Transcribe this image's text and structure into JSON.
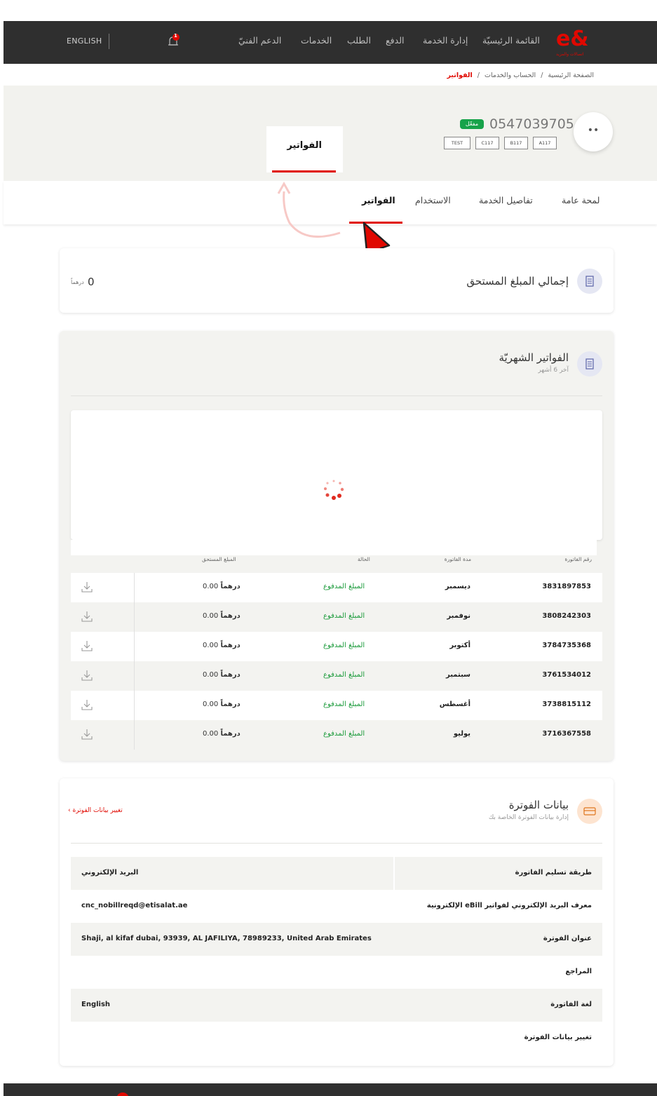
{
  "colors": {
    "brand_red": "#e00800",
    "header_bg": "#2f2f2f",
    "paid_green": "#1a9a3a",
    "active_green": "#17a34a"
  },
  "header": {
    "language_toggle": "ENGLISH",
    "notification_count": "1",
    "nav": [
      "القائمة الرئيسيّة",
      "إدارة الخدمة",
      "الدفع",
      "الطلب",
      "الخدمات",
      "الدعم الفنيّ"
    ],
    "logo_text": "e&",
    "logo_tagline": "اتصالات والمزيد"
  },
  "breadcrumb": {
    "home": "الصفحة الرئيسية",
    "sep": "/",
    "section": "الحساب والخدمات",
    "current": "الفواتير"
  },
  "profile": {
    "avatar": "••",
    "phone": "0547039705",
    "status": "مفعّل",
    "tags": [
      "A117",
      "B117",
      "C117",
      "TEST"
    ]
  },
  "zoom_card": {
    "label": "الفواتير"
  },
  "tabs": [
    "لمحة عامة",
    "تفاصيل الخدمة",
    "الاستخدام",
    "الفواتير"
  ],
  "total_due": {
    "title": "إجمالي المبلغ المستحق",
    "amount": "0",
    "currency": "درهماً"
  },
  "monthly_bills": {
    "title": "الفواتير الشهريّة",
    "subtitle": "آخر 6 أشهر",
    "columns": {
      "number": "رقم الفاتورة",
      "period": "مدة الفاتورة",
      "status": "الحالة",
      "amount": "المبلغ المستحق"
    },
    "rows": [
      {
        "number": "3831897853",
        "period": "ديسمبر",
        "status": "المبلغ المدفوع",
        "amount": "0.00",
        "currency": "درهماً"
      },
      {
        "number": "3808242303",
        "period": "نوفمبر",
        "status": "المبلغ المدفوع",
        "amount": "0.00",
        "currency": "درهماً"
      },
      {
        "number": "3784735368",
        "period": "أكتوبر",
        "status": "المبلغ المدفوع",
        "amount": "0.00",
        "currency": "درهماً"
      },
      {
        "number": "3761534012",
        "period": "سبتمبر",
        "status": "المبلغ المدفوع",
        "amount": "0.00",
        "currency": "درهماً"
      },
      {
        "number": "3738815112",
        "period": "أغسطس",
        "status": "المبلغ المدفوع",
        "amount": "0.00",
        "currency": "درهماً"
      },
      {
        "number": "3716367558",
        "period": "يوليو",
        "status": "المبلغ المدفوع",
        "amount": "0.00",
        "currency": "درهماً"
      }
    ]
  },
  "billing_info": {
    "title": "بيانات الفوترة",
    "subtitle": "إدارة بيانات الفوترة الخاصة بك",
    "change_link": "تغيير بيانات الفوترة",
    "rows": [
      {
        "label": "طريقة تسليم الفاتورة",
        "value": "البريد الإلكتروني"
      },
      {
        "label": "معرف البريد الإلكتروني لفواتير eBill الإلكترونية",
        "value": "cnc_nobillreqd@etisalat.ae"
      },
      {
        "label": "عنوان الفوترة",
        "value": "Shaji, al kifaf dubai, 93939, AL JAFILIYA, 78989233, United Arab Emirates"
      },
      {
        "label": "المراجع",
        "value": ""
      },
      {
        "label": "لغة الفاتورة",
        "value": "English"
      },
      {
        "label": "تغيير بيانات الفوترة",
        "value": ""
      }
    ]
  }
}
